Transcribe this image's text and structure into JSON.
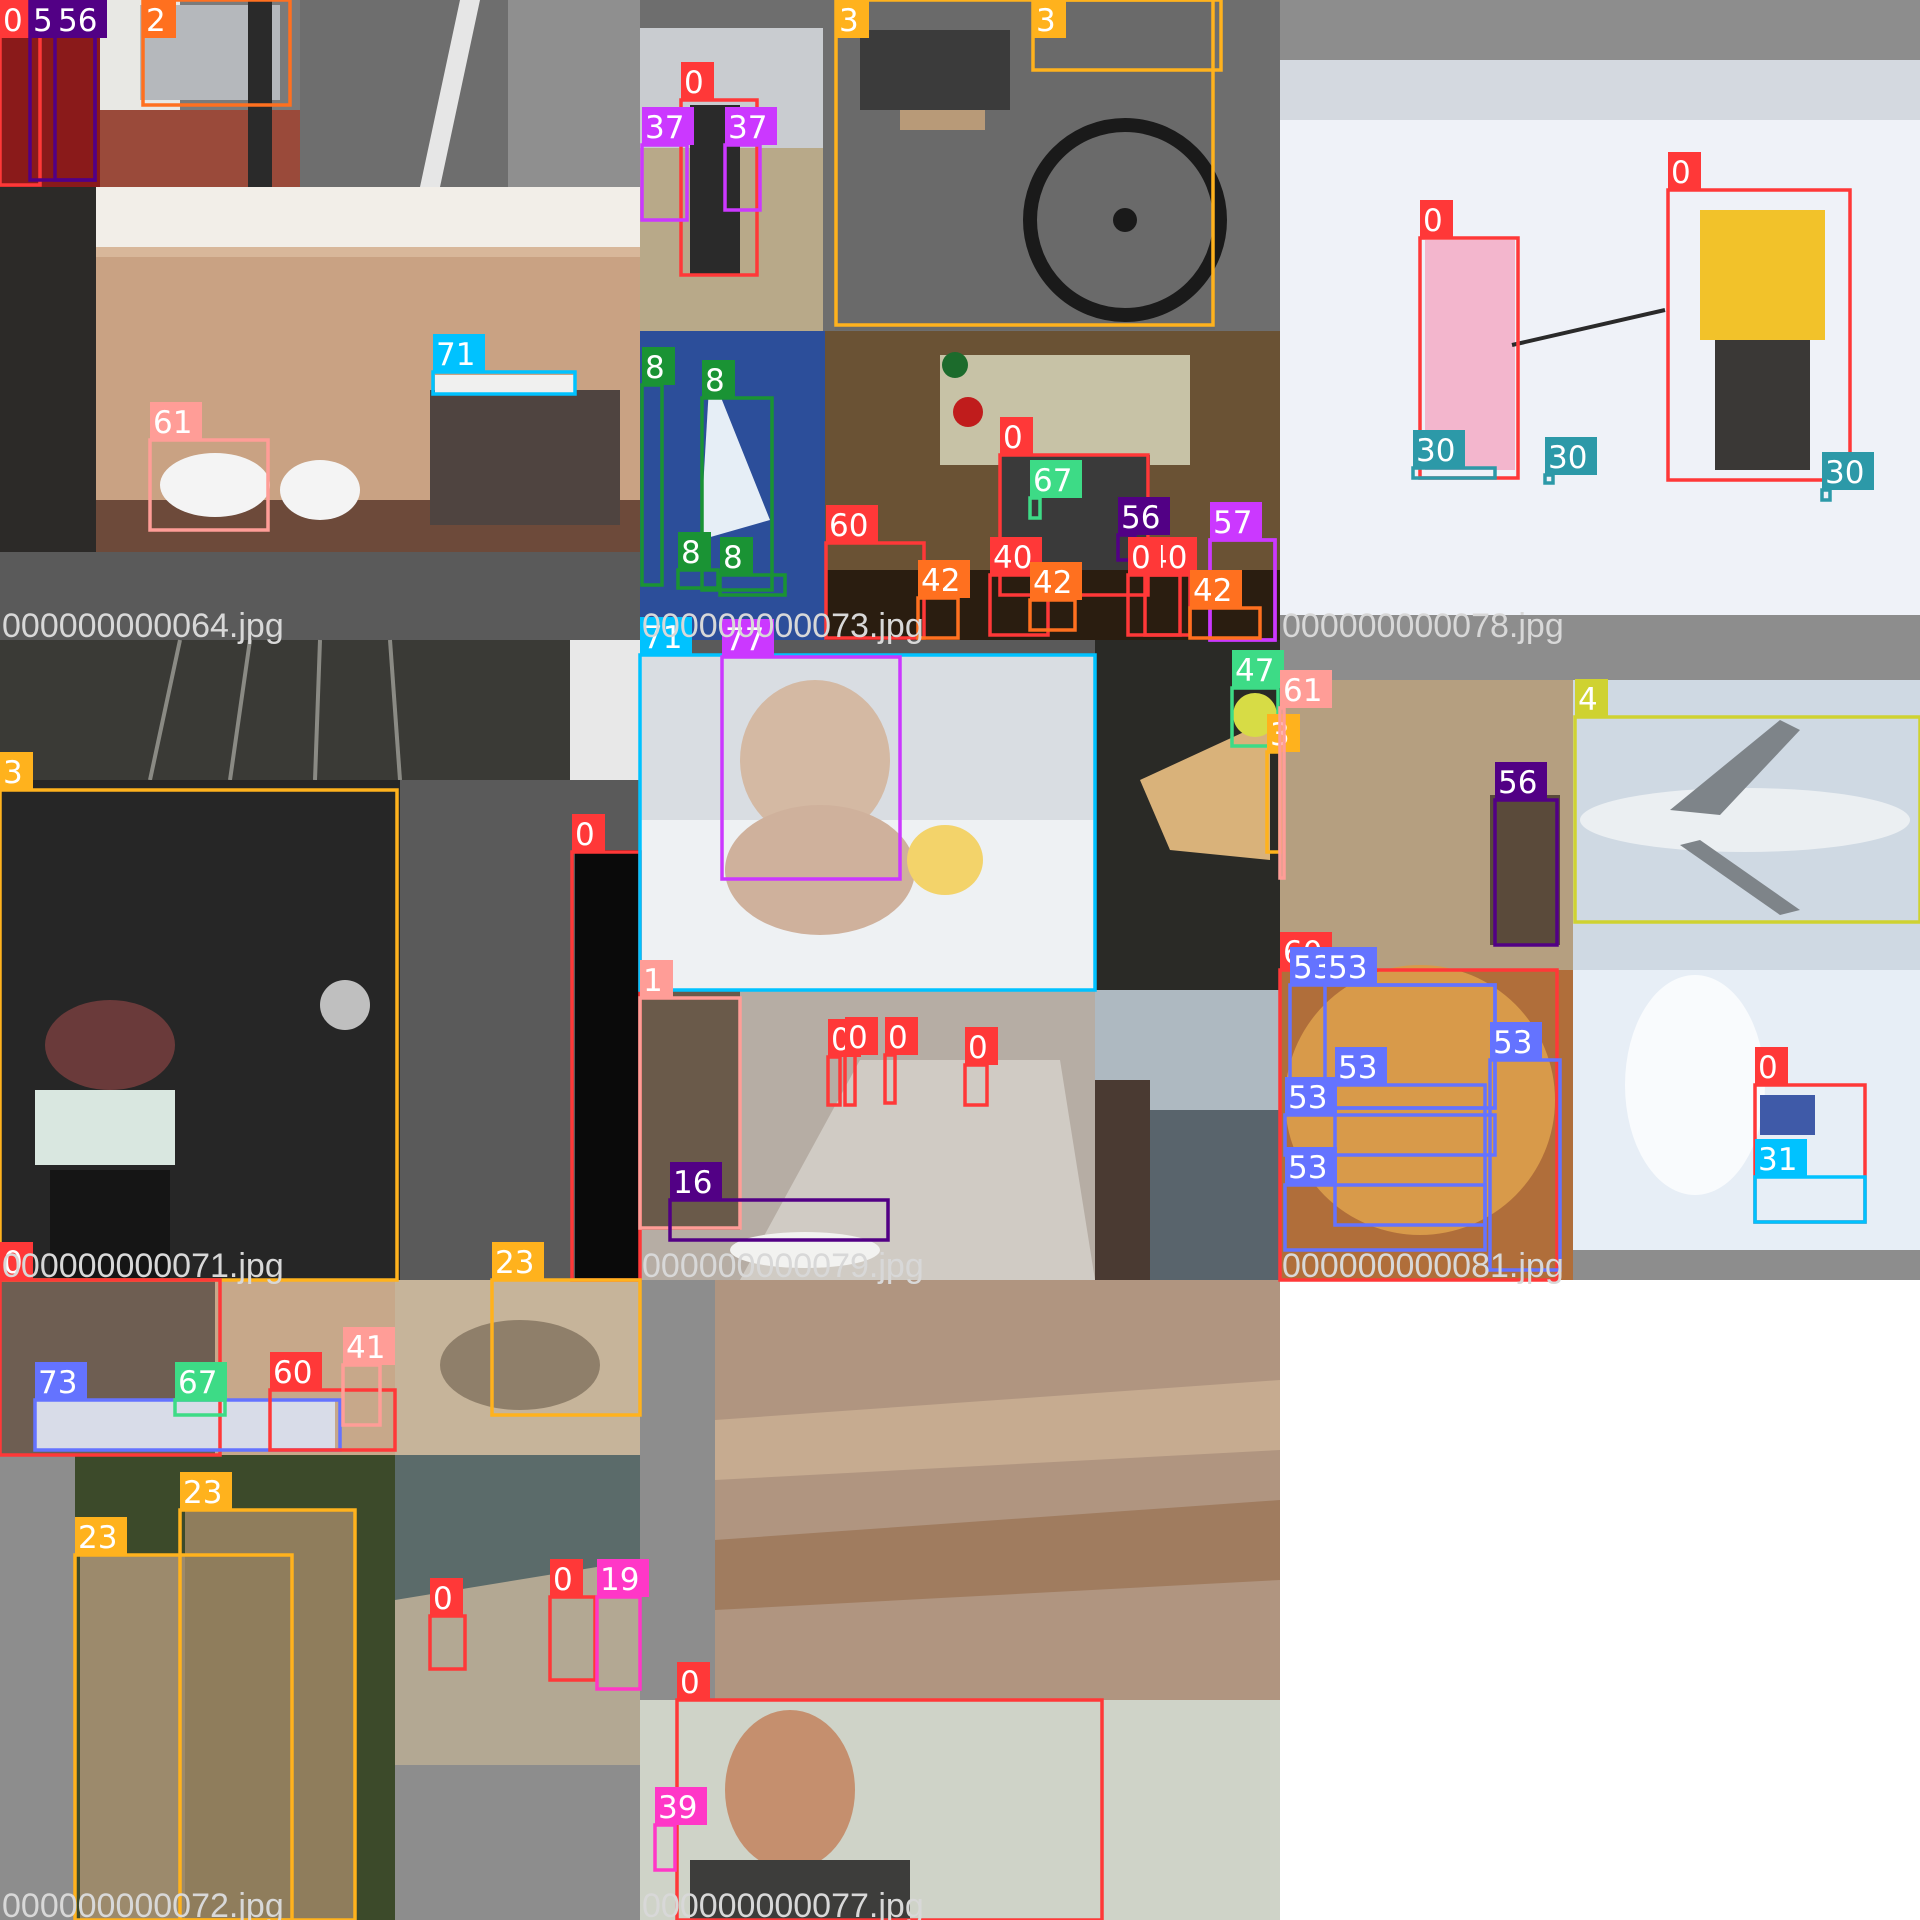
{
  "mosaic": {
    "tiles": [
      {
        "filename": "000000000064.jpg",
        "labels": [
          {
            "cls": "0",
            "color": "#ff3838"
          },
          {
            "cls": "56",
            "color": "#520085"
          },
          {
            "cls": "56",
            "color": "#520085"
          },
          {
            "cls": "2",
            "color": "#ff701f"
          },
          {
            "cls": "71",
            "color": "#00c2ff"
          },
          {
            "cls": "61",
            "color": "#ff9d97"
          }
        ]
      },
      {
        "filename": "000000000073.jpg",
        "labels": [
          {
            "cls": "0",
            "color": "#ff3838"
          },
          {
            "cls": "37",
            "color": "#cb38ff"
          },
          {
            "cls": "37",
            "color": "#cb38ff"
          },
          {
            "cls": "3",
            "color": "#ffb21d"
          },
          {
            "cls": "3",
            "color": "#ffb21d"
          },
          {
            "cls": "8",
            "color": "#1a9334"
          },
          {
            "cls": "8",
            "color": "#1a9334"
          },
          {
            "cls": "8",
            "color": "#1a9334"
          },
          {
            "cls": "8",
            "color": "#1a9334"
          },
          {
            "cls": "0",
            "color": "#ff3838"
          },
          {
            "cls": "67",
            "color": "#3ddb86"
          },
          {
            "cls": "56",
            "color": "#520085"
          },
          {
            "cls": "57",
            "color": "#cb38ff"
          },
          {
            "cls": "57",
            "color": "#cb38ff"
          },
          {
            "cls": "60",
            "color": "#ff3838"
          },
          {
            "cls": "40",
            "color": "#ff3838"
          },
          {
            "cls": "40",
            "color": "#ff3838"
          },
          {
            "cls": "0",
            "color": "#ff3838"
          },
          {
            "cls": "42",
            "color": "#ff701f"
          },
          {
            "cls": "42",
            "color": "#ff701f"
          },
          {
            "cls": "42",
            "color": "#ff701f"
          }
        ]
      },
      {
        "filename": "000000000078.jpg",
        "labels": [
          {
            "cls": "0",
            "color": "#ff3838"
          },
          {
            "cls": "0",
            "color": "#ff3838"
          },
          {
            "cls": "30",
            "color": "#2c99a8"
          },
          {
            "cls": "30",
            "color": "#2c99a8"
          },
          {
            "cls": "30",
            "color": "#2c99a8"
          }
        ]
      },
      {
        "filename": "000000000071.jpg",
        "labels": [
          {
            "cls": "3",
            "color": "#ffb21d"
          },
          {
            "cls": "0",
            "color": "#ff3838"
          }
        ]
      },
      {
        "filename": "000000000079.jpg",
        "labels": [
          {
            "cls": "71",
            "color": "#00c2ff"
          },
          {
            "cls": "77",
            "color": "#cb38ff"
          },
          {
            "cls": "47",
            "color": "#3ddb86"
          },
          {
            "cls": "3",
            "color": "#ffb21d"
          },
          {
            "cls": "1",
            "color": "#ff9d97"
          },
          {
            "cls": "16",
            "color": "#520085"
          },
          {
            "cls": "0",
            "color": "#ff3838"
          },
          {
            "cls": "0",
            "color": "#ff3838"
          },
          {
            "cls": "0",
            "color": "#ff3838"
          },
          {
            "cls": "0",
            "color": "#ff3838"
          }
        ]
      },
      {
        "filename": "000000000081.jpg",
        "labels": [
          {
            "cls": "61",
            "color": "#ff9d97"
          },
          {
            "cls": "56",
            "color": "#520085"
          },
          {
            "cls": "4",
            "color": "#cfd231"
          },
          {
            "cls": "60",
            "color": "#ff3838"
          },
          {
            "cls": "53",
            "color": "#6473ff"
          },
          {
            "cls": "53",
            "color": "#6473ff"
          },
          {
            "cls": "53",
            "color": "#6473ff"
          },
          {
            "cls": "53",
            "color": "#6473ff"
          },
          {
            "cls": "53",
            "color": "#6473ff"
          },
          {
            "cls": "53",
            "color": "#6473ff"
          },
          {
            "cls": "0",
            "color": "#ff3838"
          },
          {
            "cls": "31",
            "color": "#00c2ff"
          }
        ]
      },
      {
        "filename": "000000000072.jpg",
        "labels": [
          {
            "cls": "0",
            "color": "#ff3838"
          },
          {
            "cls": "73",
            "color": "#6473ff"
          },
          {
            "cls": "67",
            "color": "#3ddb86"
          },
          {
            "cls": "60",
            "color": "#ff3838"
          },
          {
            "cls": "41",
            "color": "#ff9d97"
          },
          {
            "cls": "23",
            "color": "#ffb21d"
          },
          {
            "cls": "23",
            "color": "#ffb21d"
          },
          {
            "cls": "23",
            "color": "#ffb21d"
          },
          {
            "cls": "0",
            "color": "#ff3838"
          },
          {
            "cls": "0",
            "color": "#ff3838"
          },
          {
            "cls": "19",
            "color": "#ff37c7"
          }
        ]
      },
      {
        "filename": "000000000077.jpg",
        "labels": [
          {
            "cls": "0",
            "color": "#ff3838"
          },
          {
            "cls": "39",
            "color": "#ff37c7"
          }
        ]
      }
    ]
  }
}
